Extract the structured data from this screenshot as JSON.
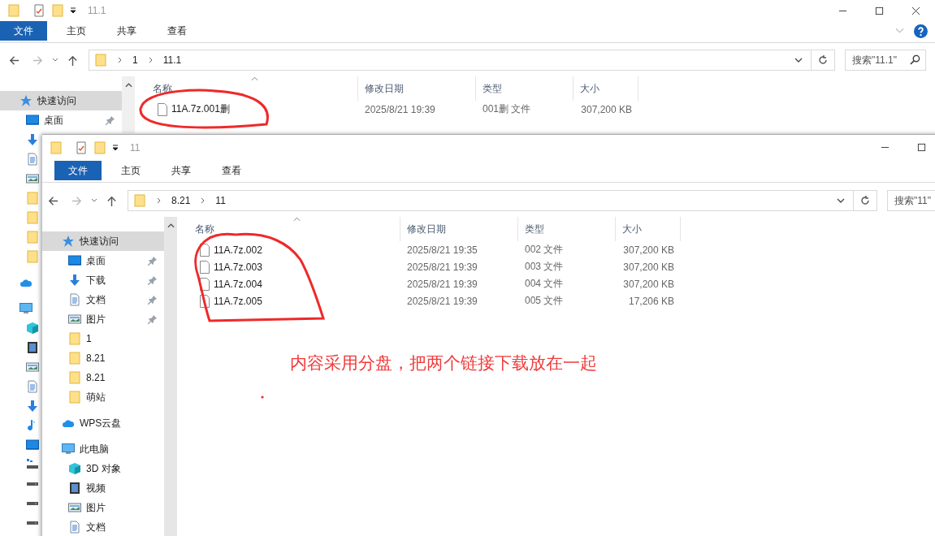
{
  "windows": [
    {
      "title": "11.1",
      "ribbon_tabs": [
        {
          "label": "文件",
          "kind": "file"
        },
        {
          "label": "主页",
          "kind": "tab"
        },
        {
          "label": "共享",
          "kind": "tab"
        },
        {
          "label": "查看",
          "kind": "tab"
        }
      ],
      "breadcrumbs": [
        "1",
        "11.1"
      ],
      "search": {
        "placeholder": "搜索\"11.1\""
      },
      "sidebar": [
        {
          "label": "快速访问",
          "kind": "star",
          "selected": true,
          "children": [
            {
              "label": "桌面",
              "kind": "desktop",
              "pinned": true,
              "selected": false
            },
            {
              "kind": "download",
              "selected": false
            },
            {
              "kind": "docs",
              "selected": false
            },
            {
              "kind": "pictures",
              "selected": false
            },
            {
              "kind": "folder",
              "selected": false
            },
            {
              "kind": "folder",
              "selected": false
            },
            {
              "kind": "folder",
              "selected": false
            },
            {
              "kind": "folder",
              "selected": false
            }
          ]
        },
        {
          "kind": "cloud",
          "selected": false
        },
        {
          "kind": "pc",
          "selected": false,
          "children": [
            {
              "kind": "cube",
              "selected": false
            },
            {
              "kind": "video",
              "selected": false
            },
            {
              "kind": "pictures",
              "selected": false
            },
            {
              "kind": "docs",
              "selected": false
            },
            {
              "kind": "download",
              "selected": false
            },
            {
              "kind": "music",
              "selected": false
            },
            {
              "kind": "desktop",
              "selected": false
            },
            {
              "kind": "netdrive",
              "selected": false
            },
            {
              "kind": "drive",
              "selected": false
            },
            {
              "kind": "drive",
              "selected": false
            },
            {
              "kind": "drive",
              "selected": false
            }
          ]
        }
      ],
      "columns": [
        "名称",
        "修改日期",
        "类型",
        "大小"
      ],
      "files": [
        {
          "name": "11A.7z.001删",
          "modified": "2025/8/21 19:39",
          "type": "001删 文件",
          "size": "307,200 KB"
        }
      ]
    },
    {
      "title": "11",
      "ribbon_tabs": [
        {
          "label": "文件",
          "kind": "file"
        },
        {
          "label": "主页",
          "kind": "tab"
        },
        {
          "label": "共享",
          "kind": "tab"
        },
        {
          "label": "查看",
          "kind": "tab"
        }
      ],
      "breadcrumbs": [
        "8.21",
        "11"
      ],
      "search": {
        "placeholder": "搜索\"11\""
      },
      "sidebar": [
        {
          "label": "快速访问",
          "kind": "star",
          "selected": true,
          "children": [
            {
              "label": "桌面",
              "kind": "desktop",
              "pinned": true,
              "selected": false
            },
            {
              "label": "下载",
              "kind": "download",
              "pinned": true,
              "selected": false
            },
            {
              "label": "文档",
              "kind": "docs",
              "pinned": true,
              "selected": false
            },
            {
              "label": "图片",
              "kind": "pictures",
              "pinned": true,
              "selected": false
            },
            {
              "label": "1",
              "kind": "folder",
              "pinned": false,
              "selected": false
            },
            {
              "label": "8.21",
              "kind": "folder",
              "pinned": false,
              "selected": false
            },
            {
              "label": "8.21",
              "kind": "folder",
              "pinned": false,
              "selected": false
            },
            {
              "label": "萌站",
              "kind": "folder",
              "pinned": false,
              "selected": false
            }
          ]
        },
        {
          "label": "WPS云盘",
          "kind": "cloud",
          "selected": false
        },
        {
          "label": "此电脑",
          "kind": "pc",
          "selected": false,
          "children": [
            {
              "label": "3D 对象",
              "kind": "cube",
              "selected": false
            },
            {
              "label": "视频",
              "kind": "video",
              "selected": false
            },
            {
              "label": "图片",
              "kind": "pictures",
              "selected": false
            },
            {
              "label": "文档",
              "kind": "docs",
              "selected": false
            }
          ]
        }
      ],
      "columns": [
        "名称",
        "修改日期",
        "类型",
        "大小"
      ],
      "files": [
        {
          "name": "11A.7z.002",
          "modified": "2025/8/21 19:35",
          "type": "002 文件",
          "size": "307,200 KB"
        },
        {
          "name": "11A.7z.003",
          "modified": "2025/8/21 19:39",
          "type": "003 文件",
          "size": "307,200 KB"
        },
        {
          "name": "11A.7z.004",
          "modified": "2025/8/21 19:39",
          "type": "004 文件",
          "size": "307,200 KB"
        },
        {
          "name": "11A.7z.005",
          "modified": "2025/8/21 19:39",
          "type": "005 文件",
          "size": "17,206 KB"
        }
      ]
    }
  ],
  "annotation": {
    "note": "内容采用分盘，把两个链接下载放在一起"
  }
}
